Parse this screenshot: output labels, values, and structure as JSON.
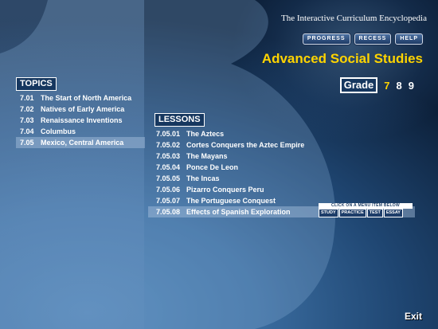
{
  "header": {
    "site_title": "The Interactive Curriculum Encyclopedia",
    "buttons": {
      "progress": "PROGRESS",
      "recess": "RECESS",
      "help": "HELP"
    },
    "course_title": "Advanced Social Studies"
  },
  "grade": {
    "label": "Grade",
    "options": [
      "7",
      "8",
      "9"
    ],
    "selected": "7"
  },
  "topics": {
    "title": "TOPICS",
    "items": [
      {
        "code": "7.01",
        "name": "The Start of North America"
      },
      {
        "code": "7.02",
        "name": "Natives of Early America"
      },
      {
        "code": "7.03",
        "name": "Renaissance Inventions"
      },
      {
        "code": "7.04",
        "name": "Columbus"
      },
      {
        "code": "7.05",
        "name": "Mexico, Central America"
      }
    ],
    "selected": "7.05"
  },
  "lessons": {
    "title": "LESSONS",
    "items": [
      {
        "code": "7.05.01",
        "name": "The Aztecs"
      },
      {
        "code": "7.05.02",
        "name": "Cortes Conquers the Aztec Empire"
      },
      {
        "code": "7.05.03",
        "name": "The Mayans"
      },
      {
        "code": "7.05.04",
        "name": "Ponce De Leon"
      },
      {
        "code": "7.05.05",
        "name": "The Incas"
      },
      {
        "code": "7.05.06",
        "name": "Pizarro Conquers Peru"
      },
      {
        "code": "7.05.07",
        "name": "The Portuguese Conquest"
      },
      {
        "code": "7.05.08",
        "name": "Effects of Spanish Exploration"
      }
    ],
    "selected": "7.05.08",
    "hint": "CLICK ON A MENU ITEM BELOW",
    "actions": {
      "study": "STUDY",
      "practice": "PRACTICE",
      "test": "TEST",
      "essay": "ESSAY"
    }
  },
  "footer": {
    "exit": "Exit"
  },
  "colors": {
    "accent_yellow": "#ffd400",
    "panel_dark": "#16375f",
    "text": "#ffffff"
  }
}
